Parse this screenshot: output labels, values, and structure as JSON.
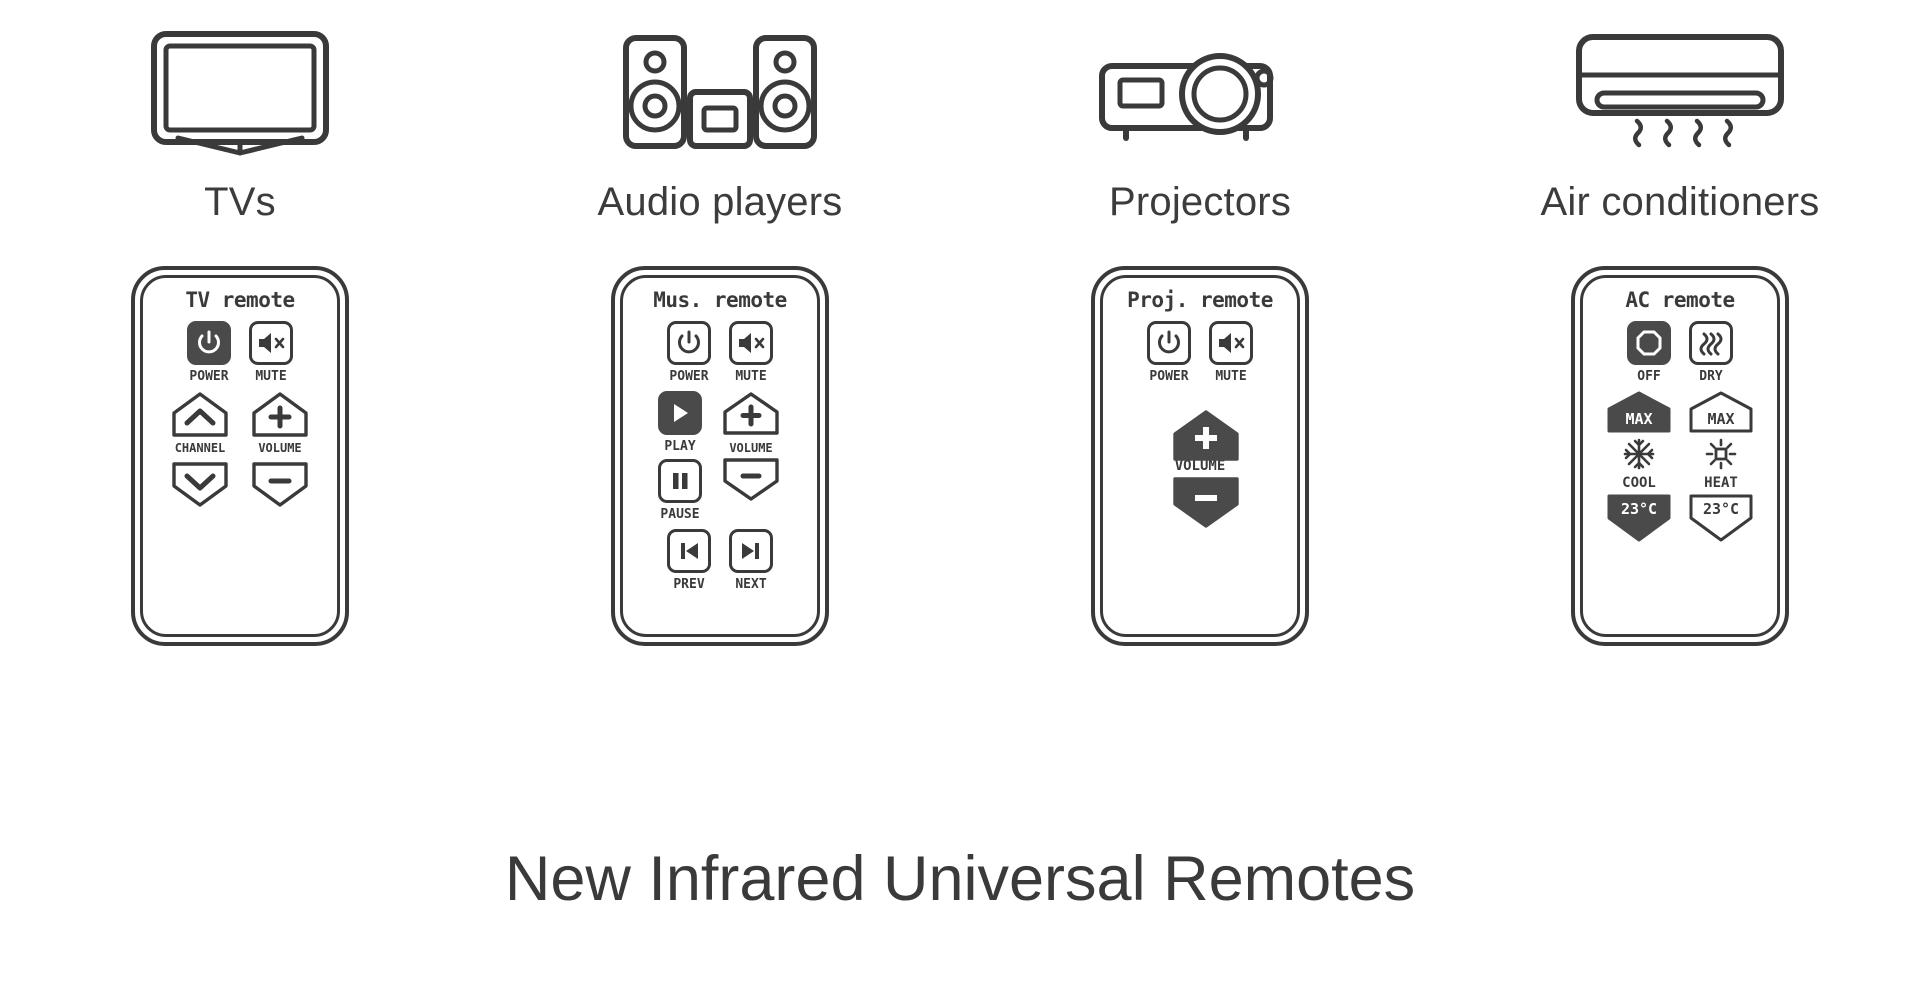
{
  "theme": {
    "background": "#ffffff",
    "ink": "#3a3a3a",
    "active_fill": "#4a4a4a",
    "label_color": "#3c3c3c"
  },
  "title": "New Infrared Universal Remotes",
  "categories": [
    {
      "id": "tvs",
      "label": "TVs",
      "icon": "tv-icon",
      "remote": {
        "title": "TV remote",
        "buttons": [
          {
            "name": "power-button",
            "label": "POWER",
            "icon": "power-icon",
            "shape": "square",
            "state": "active"
          },
          {
            "name": "mute-button",
            "label": "MUTE",
            "icon": "speaker-mute-icon",
            "shape": "square",
            "state": "inactive"
          },
          {
            "name": "channel-up-button",
            "label": "",
            "icon": "chevron-up-icon",
            "shape": "pentagon-up",
            "state": "inactive"
          },
          {
            "name": "volume-up-button",
            "label": "",
            "icon": "plus-icon",
            "shape": "pentagon-up",
            "state": "inactive"
          },
          {
            "name": "channel-label",
            "label": "CHANNEL",
            "icon": "",
            "shape": "text",
            "state": "inactive"
          },
          {
            "name": "volume-label",
            "label": "VOLUME",
            "icon": "",
            "shape": "text",
            "state": "inactive"
          },
          {
            "name": "channel-down-button",
            "label": "",
            "icon": "chevron-down-icon",
            "shape": "pentagon-down",
            "state": "inactive"
          },
          {
            "name": "volume-down-button",
            "label": "",
            "icon": "minus-icon",
            "shape": "pentagon-down",
            "state": "inactive"
          }
        ]
      }
    },
    {
      "id": "audio-players",
      "label": "Audio players",
      "icon": "audio-system-icon",
      "remote": {
        "title": "Mus. remote",
        "buttons": [
          {
            "name": "power-button",
            "label": "POWER",
            "icon": "power-icon",
            "shape": "square",
            "state": "inactive"
          },
          {
            "name": "mute-button",
            "label": "MUTE",
            "icon": "speaker-mute-icon",
            "shape": "square",
            "state": "inactive"
          },
          {
            "name": "play-button",
            "label": "PLAY",
            "icon": "play-icon",
            "shape": "square",
            "state": "active"
          },
          {
            "name": "volume-up-button",
            "label": "",
            "icon": "plus-icon",
            "shape": "pentagon-up",
            "state": "inactive"
          },
          {
            "name": "volume-label",
            "label": "VOLUME",
            "icon": "",
            "shape": "text",
            "state": "inactive"
          },
          {
            "name": "pause-button",
            "label": "PAUSE",
            "icon": "pause-icon",
            "shape": "square",
            "state": "inactive"
          },
          {
            "name": "volume-down-button",
            "label": "",
            "icon": "minus-icon",
            "shape": "pentagon-down",
            "state": "inactive"
          },
          {
            "name": "prev-button",
            "label": "PREV",
            "icon": "skip-back-icon",
            "shape": "square",
            "state": "inactive"
          },
          {
            "name": "next-button",
            "label": "NEXT",
            "icon": "skip-forward-icon",
            "shape": "square",
            "state": "inactive"
          }
        ]
      }
    },
    {
      "id": "projectors",
      "label": "Projectors",
      "icon": "projector-icon",
      "remote": {
        "title": "Proj. remote",
        "buttons": [
          {
            "name": "power-button",
            "label": "POWER",
            "icon": "power-icon",
            "shape": "square",
            "state": "inactive"
          },
          {
            "name": "mute-button",
            "label": "MUTE",
            "icon": "speaker-mute-icon",
            "shape": "square",
            "state": "inactive"
          },
          {
            "name": "volume-up-button",
            "label": "",
            "icon": "plus-icon",
            "shape": "pentagon-up",
            "state": "active"
          },
          {
            "name": "volume-label",
            "label": "VOLUME",
            "icon": "",
            "shape": "text",
            "state": "inactive"
          },
          {
            "name": "volume-down-button",
            "label": "",
            "icon": "minus-icon",
            "shape": "pentagon-down",
            "state": "active"
          }
        ]
      }
    },
    {
      "id": "air-conditioners",
      "label": "Air conditioners",
      "icon": "air-conditioner-icon",
      "remote": {
        "title": "AC remote",
        "buttons": [
          {
            "name": "off-button",
            "label": "OFF",
            "icon": "power-off-octagon-icon",
            "shape": "square",
            "state": "active"
          },
          {
            "name": "dry-button",
            "label": "DRY",
            "icon": "dry-waves-icon",
            "shape": "square",
            "state": "inactive"
          },
          {
            "name": "cool-max-button",
            "label": "MAX",
            "icon": "",
            "shape": "pentagon-up",
            "state": "active"
          },
          {
            "name": "heat-max-button",
            "label": "MAX",
            "icon": "",
            "shape": "pentagon-up",
            "state": "inactive"
          },
          {
            "name": "cool-label",
            "label": "COOL",
            "icon": "snowflake-icon",
            "shape": "text",
            "state": "inactive"
          },
          {
            "name": "heat-label",
            "label": "HEAT",
            "icon": "sun-icon",
            "shape": "text",
            "state": "inactive"
          },
          {
            "name": "cool-temp-button",
            "label": "23°C",
            "icon": "",
            "shape": "pentagon-down",
            "state": "active"
          },
          {
            "name": "heat-temp-button",
            "label": "23°C",
            "icon": "",
            "shape": "pentagon-down",
            "state": "inactive"
          }
        ]
      }
    }
  ],
  "tv_remote": {
    "title": "TV remote",
    "power": "POWER",
    "mute": "MUTE",
    "channel": "CHANNEL",
    "volume": "VOLUME"
  },
  "mus_remote": {
    "title": "Mus. remote",
    "power": "POWER",
    "mute": "MUTE",
    "play": "PLAY",
    "pause": "PAUSE",
    "prev": "PREV",
    "next": "NEXT",
    "volume": "VOLUME"
  },
  "proj_remote": {
    "title": "Proj. remote",
    "power": "POWER",
    "mute": "MUTE",
    "volume": "VOLUME"
  },
  "ac_remote": {
    "title": "AC remote",
    "off": "OFF",
    "dry": "DRY",
    "cool_max": "MAX",
    "heat_max": "MAX",
    "cool": "COOL",
    "heat": "HEAT",
    "cool_temp": "23°C",
    "heat_temp": "23°C"
  }
}
